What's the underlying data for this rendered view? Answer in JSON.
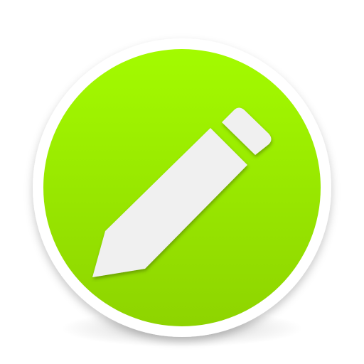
{
  "icon": {
    "name": "pencil-icon",
    "symbol": "edit-pencil"
  },
  "colors": {
    "background": "#ffffff",
    "ring": "#ffffff",
    "disc_top": "#a3fb00",
    "disc_bottom": "#8ed400",
    "pencil": "#f0f0f0"
  }
}
